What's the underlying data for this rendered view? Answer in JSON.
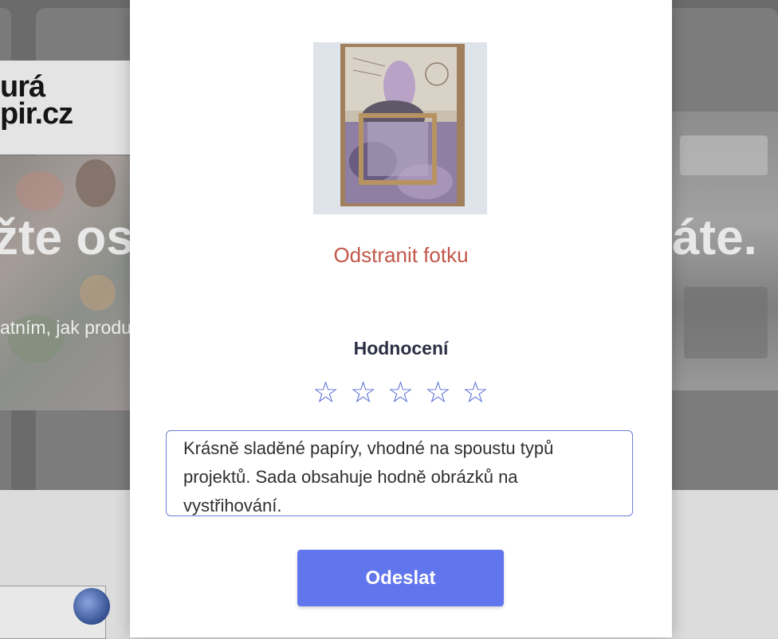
{
  "background": {
    "logo_line1": "urá",
    "logo_line2": "pir.cz",
    "hero_left": "žte ost",
    "hero_right": "áte.",
    "subtitle_left": "atním, jak produ"
  },
  "review_modal": {
    "remove_photo_label": "Odstranit fotku",
    "rating_label": "Hodnocení",
    "stars": [
      "☆",
      "☆",
      "☆",
      "☆",
      "☆"
    ],
    "review_text": "Krásně sladěné papíry, vhodné na spoustu typů projektů. Sada obsahuje hodně obrázků na vystřihování.",
    "submit_label": "Odeslat"
  },
  "colors": {
    "accent": "#6175ec",
    "remove_link": "#c2574a",
    "star": "#5a6fd6"
  }
}
